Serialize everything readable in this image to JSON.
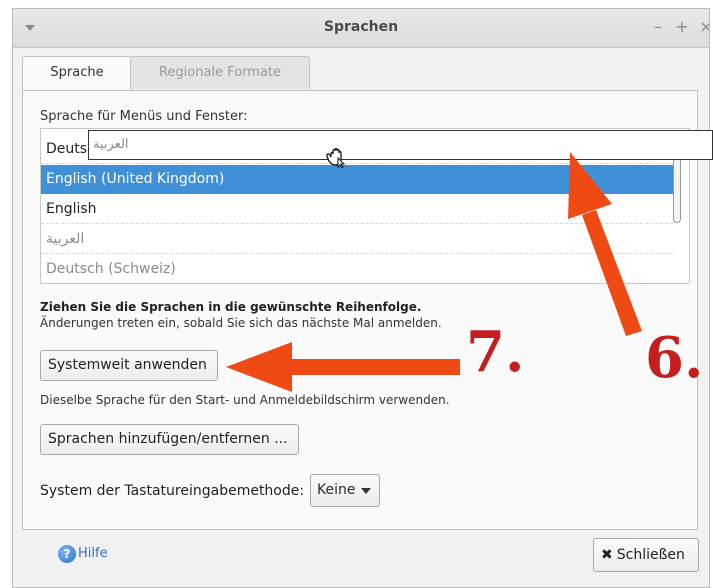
{
  "window": {
    "title": "Sprachen"
  },
  "tabs": [
    {
      "label": "Sprache",
      "active": true
    },
    {
      "label": "Regionale Formate",
      "active": false
    }
  ],
  "language_section": {
    "label": "Sprache für Menüs und Fenster:",
    "rows": [
      {
        "label": "Deuts",
        "selected": false
      },
      {
        "label": "English (United Kingdom)",
        "selected": true
      },
      {
        "label": "English",
        "selected": false
      },
      {
        "label": "العربية",
        "selected": false
      },
      {
        "label": "Deutsch (Schweiz)",
        "selected": false
      }
    ],
    "drag_item": "العربية"
  },
  "hints": {
    "bold": "Ziehen Sie die Sprachen in die gewünschte Reihenfolge.",
    "normal": "Änderungen treten ein, sobald Sie sich das nächste Mal anmelden."
  },
  "buttons": {
    "system_wide": "Systemweit anwenden",
    "system_wide_note": "Dieselbe Sprache für den Start- und Anmeldebildschirm verwenden.",
    "add_remove": "Sprachen hinzufügen/entfernen ..."
  },
  "input_method": {
    "label": "System der Tastatureingabemethode:",
    "value": "Keine"
  },
  "footer": {
    "help": "Hilfe",
    "close": "Schließen"
  },
  "annotations": {
    "step7": "7.",
    "step6": "6.",
    "color": "#f04a14"
  },
  "colors": {
    "selection": "#3f90d6",
    "annotation_text": "#c41e1e"
  }
}
